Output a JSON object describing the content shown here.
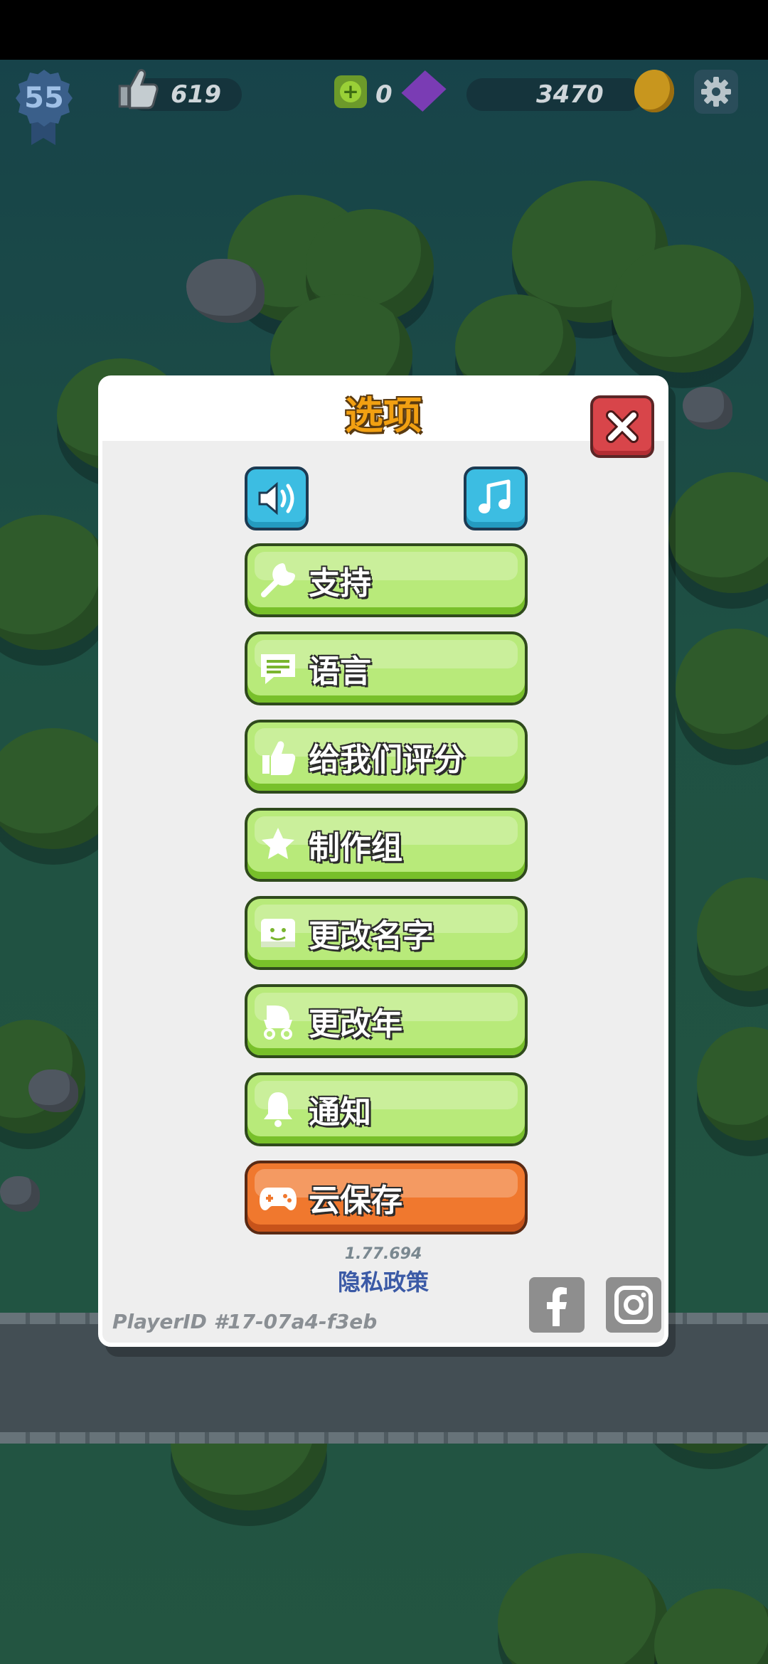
{
  "hud": {
    "level": "55",
    "likes": "619",
    "gems": "0",
    "coins": "3470"
  },
  "dialog": {
    "title": "选项",
    "buttons": [
      {
        "label": "支持",
        "icon": "wrench-icon"
      },
      {
        "label": "语言",
        "icon": "chat-icon"
      },
      {
        "label": "给我们评分",
        "icon": "thumbs-up-icon"
      },
      {
        "label": "制作组",
        "icon": "star-icon"
      },
      {
        "label": "更改名字",
        "icon": "name-tag-icon"
      },
      {
        "label": "更改年",
        "icon": "stroller-icon"
      },
      {
        "label": "通知",
        "icon": "bell-icon"
      },
      {
        "label": "云保存",
        "icon": "gamepad-icon"
      }
    ],
    "version": "1.77.694",
    "privacy": "隐私政策",
    "player_id": "PlayerID #17-07a4-f3eb"
  },
  "colors": {
    "green_button": "#b8ea7a",
    "orange_button": "#f0782e",
    "title": "#f2a012",
    "close": "#d8454a",
    "sound_button": "#3cbde2"
  }
}
